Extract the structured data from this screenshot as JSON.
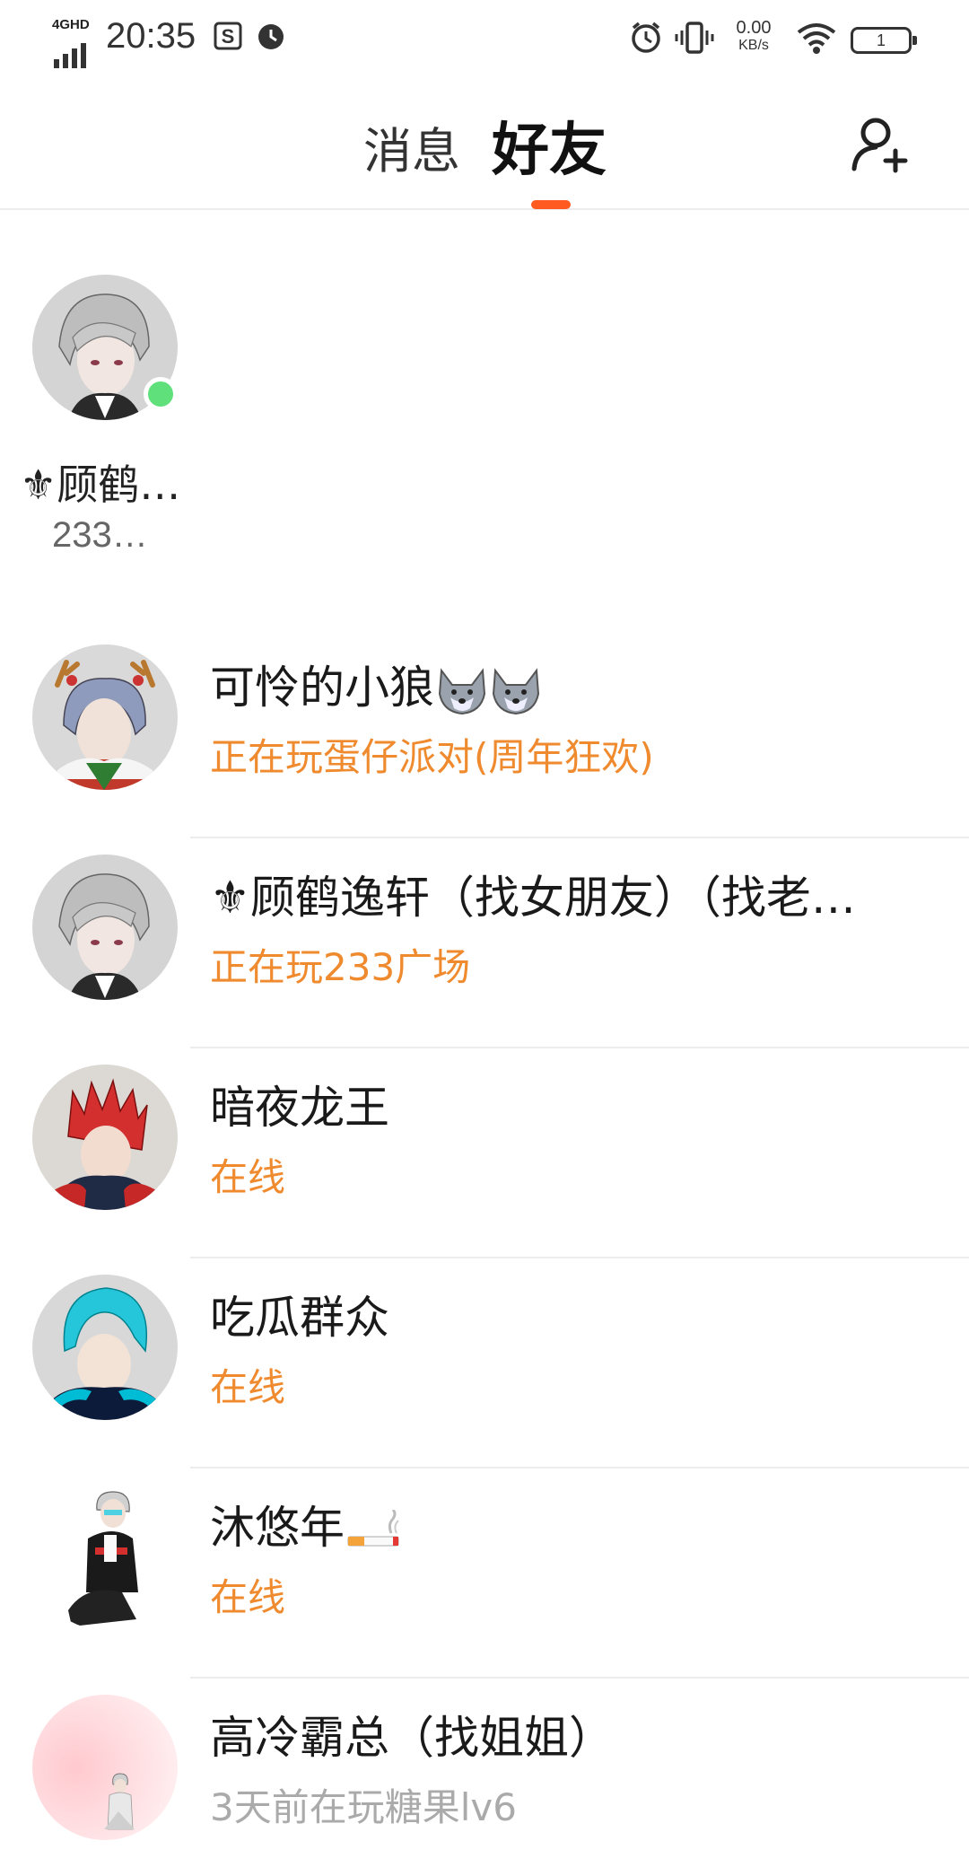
{
  "status_bar": {
    "network": "4GHD",
    "time": "20:35",
    "speed_value": "0.00",
    "speed_unit": "KB/s",
    "battery": "1"
  },
  "header": {
    "tab_messages": "消息",
    "tab_friends": "好友",
    "accent_color": "#ff5a1f",
    "add_friend_icon": "add-user-icon"
  },
  "featured_friend": {
    "name": "⚜顾鹤…",
    "subtitle": "233…",
    "online": true,
    "online_color": "#5fe07b"
  },
  "friends": [
    {
      "name": "可怜的小狼",
      "status": "正在玩蛋仔派对(周年狂欢)",
      "status_type": "playing",
      "emoji": "wolf"
    },
    {
      "name": "⚜顾鹤逸轩（找女朋友）（找老…",
      "status": "正在玩233广场",
      "status_type": "playing"
    },
    {
      "name": "暗夜龙王",
      "status": "在线",
      "status_type": "online"
    },
    {
      "name": "吃瓜群众",
      "status": "在线",
      "status_type": "online"
    },
    {
      "name": "沐悠年",
      "status": "在线",
      "status_type": "online",
      "emoji": "cigarette"
    },
    {
      "name": "高冷霸总（找姐姐）",
      "status": "3天前在玩糖果lv6",
      "status_type": "offline"
    }
  ],
  "colors": {
    "status_playing": "#ef8a2e",
    "status_offline": "#aaaaaa"
  }
}
